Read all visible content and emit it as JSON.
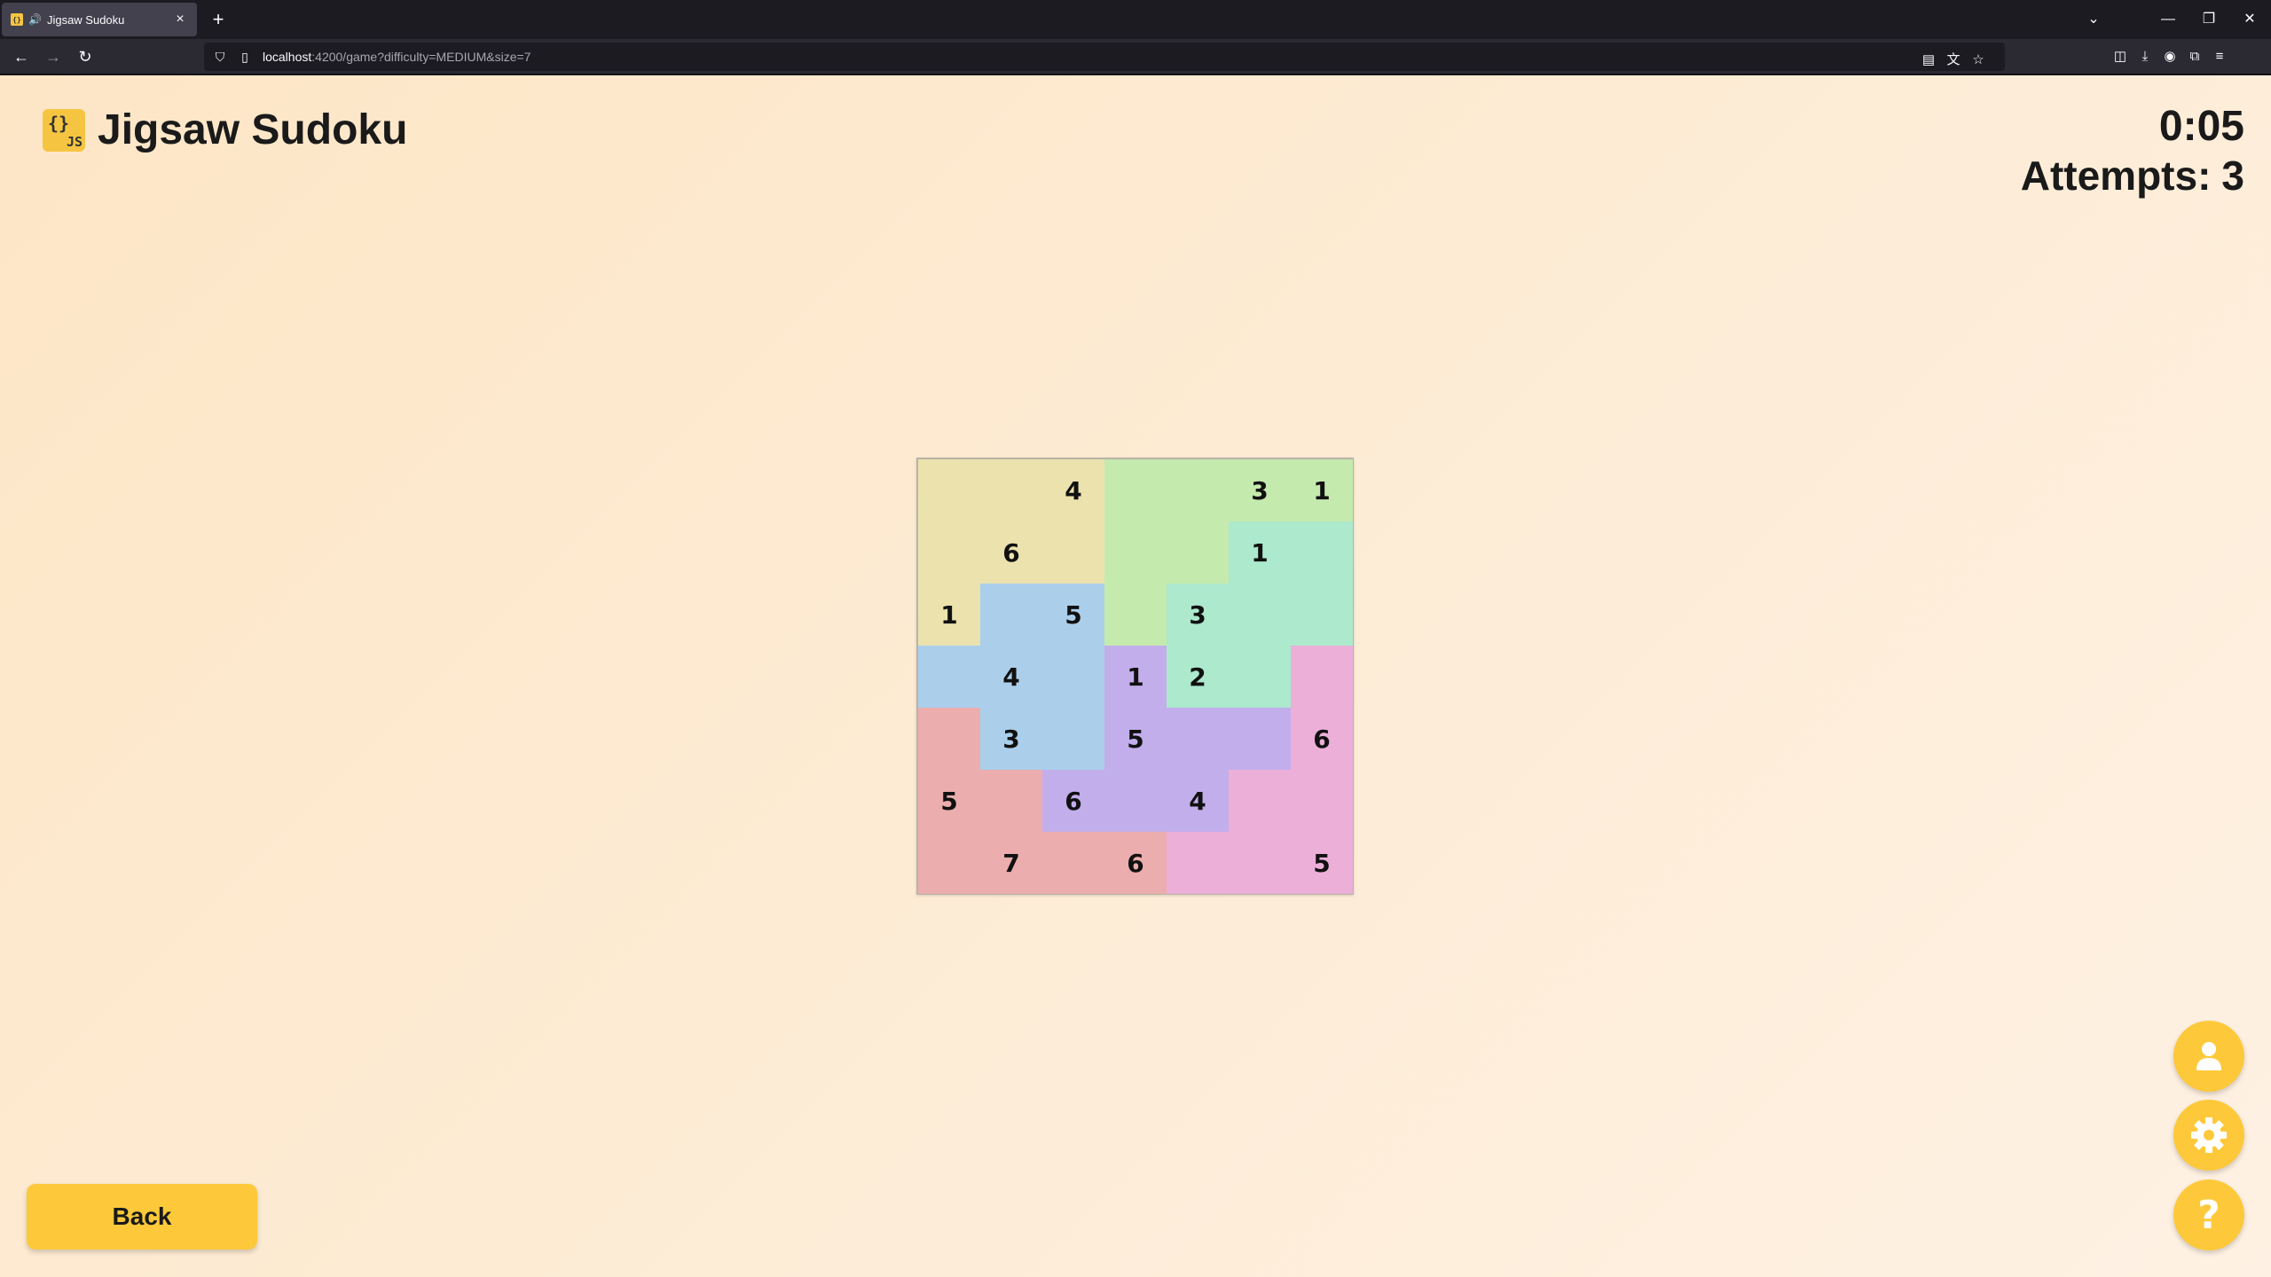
{
  "browser": {
    "tab_title": "Jigsaw Sudoku",
    "new_tab": "+",
    "url_host": "localhost",
    "url_rest": ":4200/game?difficulty=MEDIUM&size=7"
  },
  "app": {
    "logo_braces": "{}",
    "logo_js": "JS",
    "title": "Jigsaw Sudoku"
  },
  "stats": {
    "timer": "0:05",
    "attempts_label": "Attempts:",
    "attempts_value": "3"
  },
  "board": {
    "size": 7,
    "region_colors": {
      "A": "#ebe2ad",
      "B": "#c5eaad",
      "C": "#ace9cd",
      "D": "#abcfeb",
      "E": "#c3aeec",
      "F": "#ebafd8",
      "G": "#ebadad"
    },
    "regions": [
      [
        "A",
        "A",
        "A",
        "B",
        "B",
        "B",
        "B"
      ],
      [
        "A",
        "A",
        "A",
        "B",
        "B",
        "C",
        "C"
      ],
      [
        "A",
        "D",
        "D",
        "B",
        "C",
        "C",
        "C"
      ],
      [
        "D",
        "D",
        "D",
        "E",
        "C",
        "C",
        "F"
      ],
      [
        "G",
        "D",
        "D",
        "E",
        "E",
        "E",
        "F"
      ],
      [
        "G",
        "G",
        "E",
        "E",
        "E",
        "F",
        "F"
      ],
      [
        "G",
        "G",
        "G",
        "G",
        "F",
        "F",
        "F"
      ]
    ],
    "cells": [
      [
        "",
        "",
        "4",
        "",
        "",
        "3",
        "1"
      ],
      [
        "",
        "6",
        "",
        "",
        "",
        "1",
        ""
      ],
      [
        "1",
        "",
        "5",
        "",
        "3",
        "",
        ""
      ],
      [
        "",
        "4",
        "",
        "1",
        "2",
        "",
        ""
      ],
      [
        "",
        "3",
        "",
        "5",
        "",
        "",
        "6"
      ],
      [
        "5",
        "",
        "6",
        "",
        "4",
        "",
        ""
      ],
      [
        "",
        "7",
        "",
        "6",
        "",
        "",
        "5"
      ]
    ]
  },
  "buttons": {
    "back": "Back",
    "profile_icon": "user-icon",
    "settings_icon": "gear-icon",
    "help_icon": "question-icon",
    "help_glyph": "?"
  },
  "colors": {
    "accent": "#fdc93b"
  }
}
